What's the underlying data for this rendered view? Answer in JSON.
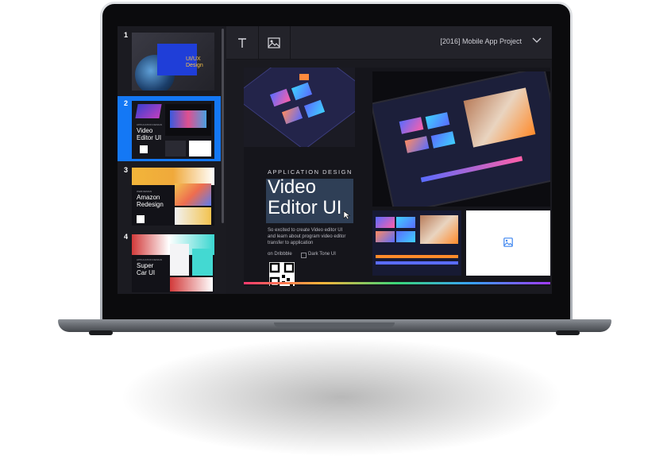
{
  "window": {
    "title": "[2016] Mobile App Project"
  },
  "toolbar": {
    "text_tool": "text-tool",
    "image_tool": "image-tool"
  },
  "slides": [
    {
      "num": "1",
      "title": "UI/UX",
      "subtitle": "Design"
    },
    {
      "num": "2",
      "eyebrow": "APPLICATION DESIGN",
      "title": "Video",
      "subtitle": "Editor UI",
      "selected": true
    },
    {
      "num": "3",
      "eyebrow": "WEB DESIGN",
      "title": "Amazon",
      "subtitle": "Redesign"
    },
    {
      "num": "4",
      "eyebrow": "APPLICATION DESIGN",
      "title": "Super",
      "subtitle": "Car UI"
    }
  ],
  "main": {
    "eyebrow": "APPLICATION DESIGN",
    "title_line1": "Video",
    "title_line2": "Editor UI",
    "description": [
      "So excited to create Video editor UI",
      "and learn about program video editor",
      "transfer to application"
    ],
    "link1": "on Dribbble",
    "link2": "Dark Tone UI"
  },
  "colors": {
    "accent": "#1a73f0",
    "selected_bg": "#1478f5",
    "bg": "#1e1e24",
    "image_placeholder": "#3d85f0"
  },
  "icons": [
    "text-icon",
    "image-icon",
    "chevron-down-icon",
    "image-placeholder-icon",
    "cursor-icon"
  ]
}
